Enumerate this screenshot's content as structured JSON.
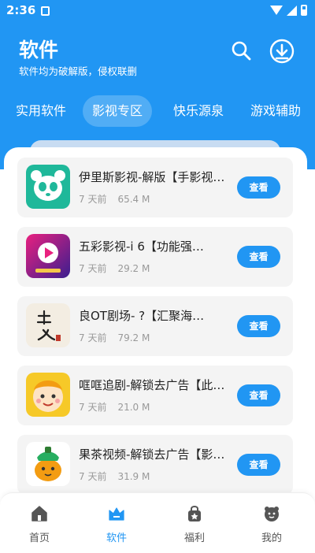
{
  "status_bar": {
    "time": "2:36"
  },
  "header": {
    "title": "软件",
    "subtitle": "软件均为破解版，侵权联删",
    "search_icon": "search-icon",
    "download_icon": "download-icon"
  },
  "tabs": [
    {
      "label": "实用软件",
      "active": false
    },
    {
      "label": "影视专区",
      "active": true
    },
    {
      "label": "快乐源泉",
      "active": false
    },
    {
      "label": "游戏辅助",
      "active": false
    }
  ],
  "apps": [
    {
      "title": "伊里斯影视-解版【手影视…",
      "time": "7 天前",
      "size": "65.4 M",
      "button": "查看",
      "icon": "panda-icon"
    },
    {
      "title": "五彩影视-i      6【功能强…",
      "time": "7 天前",
      "size": "29.2 M",
      "button": "查看",
      "icon": "play-icon"
    },
    {
      "title": "良OT剧场-           ?【汇聚海…",
      "time": "7 天前",
      "size": "79.2 M",
      "button": "查看",
      "icon": "calligraphy-icon"
    },
    {
      "title": "哐哐追剧-解锁去广告【此…",
      "time": "7 天前",
      "size": "21.0 M",
      "button": "查看",
      "icon": "cartoon-face-icon"
    },
    {
      "title": "果茶视频-解锁去广告【影…",
      "time": "7 天前",
      "size": "31.9 M",
      "button": "查看",
      "icon": "fruit-tea-icon"
    }
  ],
  "bottom_nav": [
    {
      "label": "首页",
      "active": false,
      "icon": "home-icon"
    },
    {
      "label": "软件",
      "active": true,
      "icon": "crown-icon"
    },
    {
      "label": "福利",
      "active": false,
      "icon": "gift-bag-icon"
    },
    {
      "label": "我的",
      "active": false,
      "icon": "profile-icon"
    }
  ],
  "colors": {
    "primary": "#2196f3",
    "card_bg": "#f4f4f4",
    "meta_text": "#999999"
  }
}
